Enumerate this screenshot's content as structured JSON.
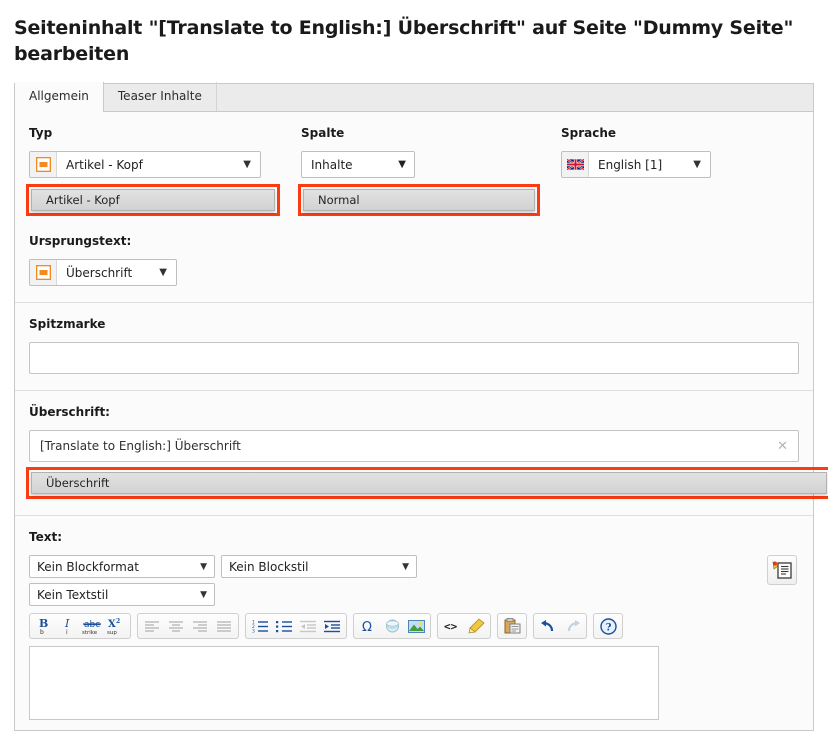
{
  "page": {
    "title": "Seiteninhalt \"[Translate to English:] Überschrift\" auf Seite \"Dummy Seite\" bearbeiten"
  },
  "tabs": [
    {
      "label": "Allgemein",
      "active": true
    },
    {
      "label": "Teaser Inhalte",
      "active": false
    }
  ],
  "fields": {
    "typ": {
      "label": "Typ",
      "value": "Artikel - Kopf",
      "icon": "content-element-icon",
      "open_option": "Artikel - Kopf",
      "highlighted": true
    },
    "spalte": {
      "label": "Spalte",
      "value": "Inhalte",
      "open_option": "Normal",
      "highlighted": true
    },
    "sprache": {
      "label": "Sprache",
      "value": "English [1]",
      "icon": "uk-flag-icon"
    },
    "ursprungstext": {
      "label": "Ursprungstext:",
      "value": "Überschrift",
      "icon": "content-element-icon"
    },
    "spitzmarke": {
      "label": "Spitzmarke",
      "value": "",
      "placeholder": ""
    },
    "ueberschrift": {
      "label": "Überschrift:",
      "value": "[Translate to English:] Überschrift",
      "clear_icon": "clear-x-icon",
      "open_option": "Überschrift",
      "highlighted": true
    },
    "text": {
      "label": "Text:",
      "blockformat": "Kein Blockformat",
      "blockstil": "Kein Blockstil",
      "textstil": "Kein Textstil",
      "body": ""
    }
  },
  "toolbar": {
    "groups": [
      {
        "name": "formatting",
        "buttons": [
          "bold-icon",
          "italic-icon",
          "strikethrough-icon",
          "superscript-icon"
        ]
      },
      {
        "name": "alignment",
        "buttons": [
          "align-left-icon",
          "align-center-icon",
          "align-right-icon",
          "align-justify-icon"
        ]
      },
      {
        "name": "lists",
        "buttons": [
          "numbered-list-icon",
          "bulleted-list-icon",
          "outdent-icon",
          "indent-icon"
        ]
      },
      {
        "name": "insert",
        "buttons": [
          "special-character-icon",
          "link-icon",
          "image-icon"
        ]
      },
      {
        "name": "source",
        "buttons": [
          "source-code-icon",
          "remove-format-icon"
        ]
      },
      {
        "name": "clipboard",
        "buttons": [
          "paste-icon"
        ]
      },
      {
        "name": "history",
        "buttons": [
          "undo-icon",
          "redo-icon"
        ]
      },
      {
        "name": "help",
        "buttons": [
          "help-icon"
        ]
      }
    ],
    "side_button": "rte-fullscreen-icon"
  },
  "colors": {
    "highlight": "#fb3b12",
    "accent_orange": "#f18a21",
    "icon_blue": "#1a4f9c",
    "panel_bg": "#fbfbfb",
    "tab_bg": "#ebebeb"
  }
}
